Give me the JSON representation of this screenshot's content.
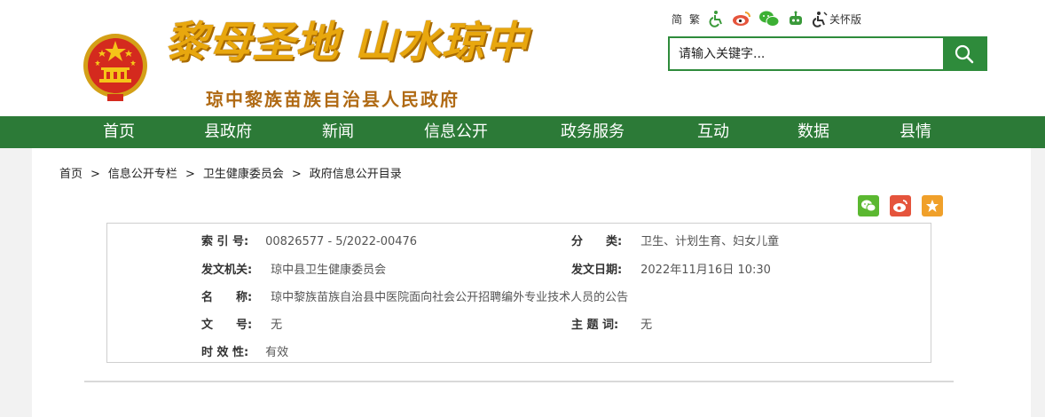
{
  "header": {
    "slogan": "黎母圣地 山水琼中",
    "gov_name": "琼中黎族苗族自治县人民政府",
    "toolbar": {
      "simplified": "简",
      "traditional": "繁",
      "elderly_label": "关怀版"
    },
    "search": {
      "placeholder": "请输入关键字..."
    }
  },
  "nav": {
    "items": [
      "首页",
      "县政府",
      "新闻",
      "信息公开",
      "政务服务",
      "互动",
      "数据",
      "县情"
    ]
  },
  "breadcrumb": {
    "items": [
      "首页",
      "信息公开专栏",
      "卫生健康委员会",
      "政府信息公开目录"
    ],
    "separator": ">"
  },
  "meta": {
    "index_label": "索 引 号:",
    "index_value": "00826577 - 5/2022-00476",
    "category_label": "分　　类:",
    "category_value": "卫生、计划生育、妇女儿童",
    "issuer_label": "发文机关:",
    "issuer_value": "琼中县卫生健康委员会",
    "date_label": "发文日期:",
    "date_value": "2022年11月16日 10:30",
    "title_label": "名　　称:",
    "title_value": "琼中黎族苗族自治县中医院面向社会公开招聘编外专业技术人员的公告",
    "docno_label": "文　　号:",
    "docno_value": "无",
    "keywords_label": "主 题 词:",
    "keywords_value": "无",
    "validity_label": "时 效 性:",
    "validity_value": "有效"
  },
  "colors": {
    "nav_green": "#2c7a37",
    "search_green": "#2e8b3b",
    "slogan_gold": "#e8a70e",
    "wechat": "#5bb831",
    "weibo": "#e5543c",
    "favorite": "#f0a02a"
  }
}
